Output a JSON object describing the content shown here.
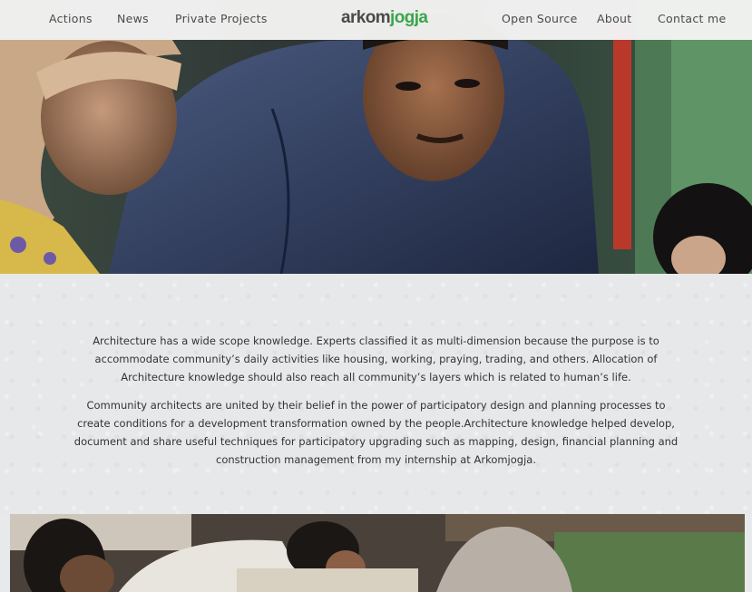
{
  "nav": {
    "left_links": [
      "Actions",
      "News",
      "Private Projects"
    ],
    "right_links": [
      "Open Source",
      "About",
      "Contact me"
    ],
    "logo": {
      "part1": "arkom",
      "part2": "jogja",
      "color_dark": "#4a4a4a",
      "color_green": "#3aa64a"
    }
  },
  "intro": {
    "paragraph1_lines": [
      "Architecture has a wide scope knowledge. Experts classified it as multi-dimension because the purpose is to",
      "accommodate community’s daily activities like housing, working, praying, trading, and others. Allocation of",
      "Architecture knowledge should also reach all community’s layers which is related to human’s life."
    ],
    "paragraph2_lines": [
      "Community architects are united by their belief in the power of participatory design and planning processes to",
      "create conditions for a development transformation owned by the people.Architecture knowledge helped develop,",
      "document and share useful techniques for participatory upgrading such as mapping, design, financial planning and",
      "construction management from my internship at Arkomjogja."
    ]
  }
}
